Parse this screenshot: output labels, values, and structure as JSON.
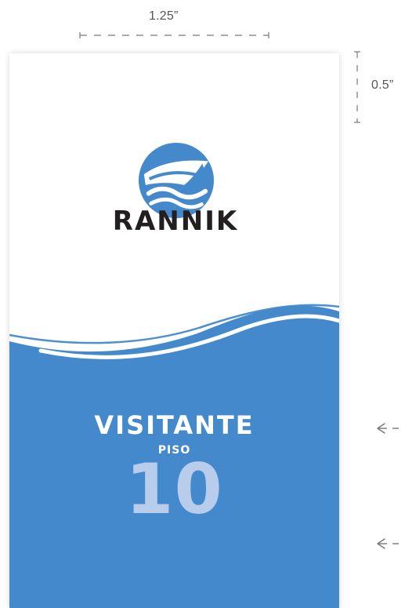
{
  "dimensions": {
    "width_label": "1.25”",
    "height_label": "0.5”",
    "line_color": "#666666"
  },
  "badge": {
    "brand_name": "RANNIK",
    "title": "VISITANTE",
    "floor_label": "PISO",
    "floor_number": "10"
  },
  "colors": {
    "brand_blue": "#4489cb",
    "number_blue": "#b8cceb",
    "text_dark": "#231f20",
    "text_light": "#ffffff"
  },
  "icons": {
    "logo": "boat-wave-logo-icon",
    "side_arrows": [
      "arrow-left-icon",
      "arrow-left-icon"
    ]
  }
}
